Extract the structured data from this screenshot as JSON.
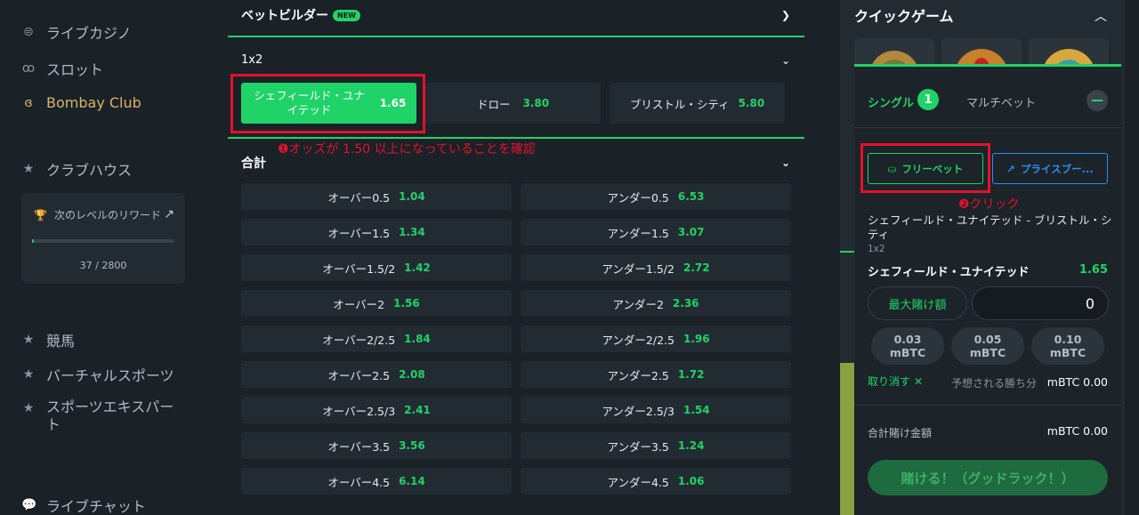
{
  "sidebar": {
    "items": [
      {
        "label": "ライブカジノ",
        "icon": "casino-chip-icon"
      },
      {
        "label": "スロット",
        "icon": "cherry-icon"
      },
      {
        "label": "Bombay Club",
        "icon": "flame-icon"
      },
      {
        "label": "クラブハウス",
        "icon": "star-icon"
      },
      {
        "label": "競馬",
        "icon": "star-icon"
      },
      {
        "label": "バーチャルスポーツ",
        "icon": "star-icon"
      },
      {
        "label": "スポーツエキスパート",
        "icon": "star-icon"
      },
      {
        "label": "ライブチャット",
        "icon": "chat-icon"
      }
    ],
    "reward": {
      "title": "次のレベルのリワード",
      "progress_text": "37 / 2800",
      "progress_fraction": 0.013
    }
  },
  "main": {
    "bet_builder": {
      "title": "ベットビルダー",
      "badge": "NEW"
    },
    "market_1x2": {
      "title": "1x2",
      "outcomes": [
        {
          "label": "シェフィールド・ユナイテッド",
          "odds": "1.65",
          "selected": true
        },
        {
          "label": "ドロー",
          "odds": "3.80",
          "selected": false
        },
        {
          "label": "ブリストル・シティ",
          "odds": "5.80",
          "selected": false
        }
      ]
    },
    "annotation_1": "❶オッズが 1.50 以上になっていることを確認",
    "totals": {
      "title": "合計",
      "rows": [
        {
          "over": "オーバー0.5",
          "over_odds": "1.04",
          "under": "アンダー0.5",
          "under_odds": "6.53"
        },
        {
          "over": "オーバー1.5",
          "over_odds": "1.34",
          "under": "アンダー1.5",
          "under_odds": "3.07"
        },
        {
          "over": "オーバー1.5/2",
          "over_odds": "1.42",
          "under": "アンダー1.5/2",
          "under_odds": "2.72"
        },
        {
          "over": "オーバー2",
          "over_odds": "1.56",
          "under": "アンダー2",
          "under_odds": "2.36"
        },
        {
          "over": "オーバー2/2.5",
          "over_odds": "1.84",
          "under": "アンダー2/2.5",
          "under_odds": "1.96"
        },
        {
          "over": "オーバー2.5",
          "over_odds": "2.08",
          "under": "アンダー2.5",
          "under_odds": "1.72"
        },
        {
          "over": "オーバー2.5/3",
          "over_odds": "2.41",
          "under": "アンダー2.5/3",
          "under_odds": "1.54"
        },
        {
          "over": "オーバー3.5",
          "over_odds": "3.56",
          "under": "アンダー3.5",
          "under_odds": "1.24"
        },
        {
          "over": "オーバー4.5",
          "over_odds": "6.14",
          "under": "アンダー4.5",
          "under_odds": "1.06"
        }
      ]
    }
  },
  "right": {
    "quick_games_title": "クイックゲーム",
    "betslip": {
      "tab_single": "シングル",
      "single_count": "1",
      "tab_multi": "マルチベット",
      "freebet_label": "フリーベット",
      "priceboost_label": "プライスブー...",
      "annotation_2": "❷クリック",
      "match": "シェフィールド・ユナイテッド - ブリストル・シティ",
      "market": "1x2",
      "selection": "シェフィールド・ユナイテッド",
      "selection_odds": "1.65",
      "max_stake_label": "最大賭け額",
      "stake_value": "0",
      "quick_amounts": [
        {
          "amount": "0.03",
          "unit": "mBTC"
        },
        {
          "amount": "0.05",
          "unit": "mBTC"
        },
        {
          "amount": "0.10",
          "unit": "mBTC"
        }
      ],
      "cancel_label": "取り消す",
      "est_win_label": "予想される勝ち分",
      "est_win_value": "mBTC 0.00",
      "total_label": "合計賭け金額",
      "total_value": "mBTC  0.00",
      "place_bet_label": "賭ける！（グッドラック！）"
    }
  },
  "colors": {
    "accent": "#1fd368",
    "annotation": "#e2122c",
    "boost": "#2b8ef5"
  }
}
